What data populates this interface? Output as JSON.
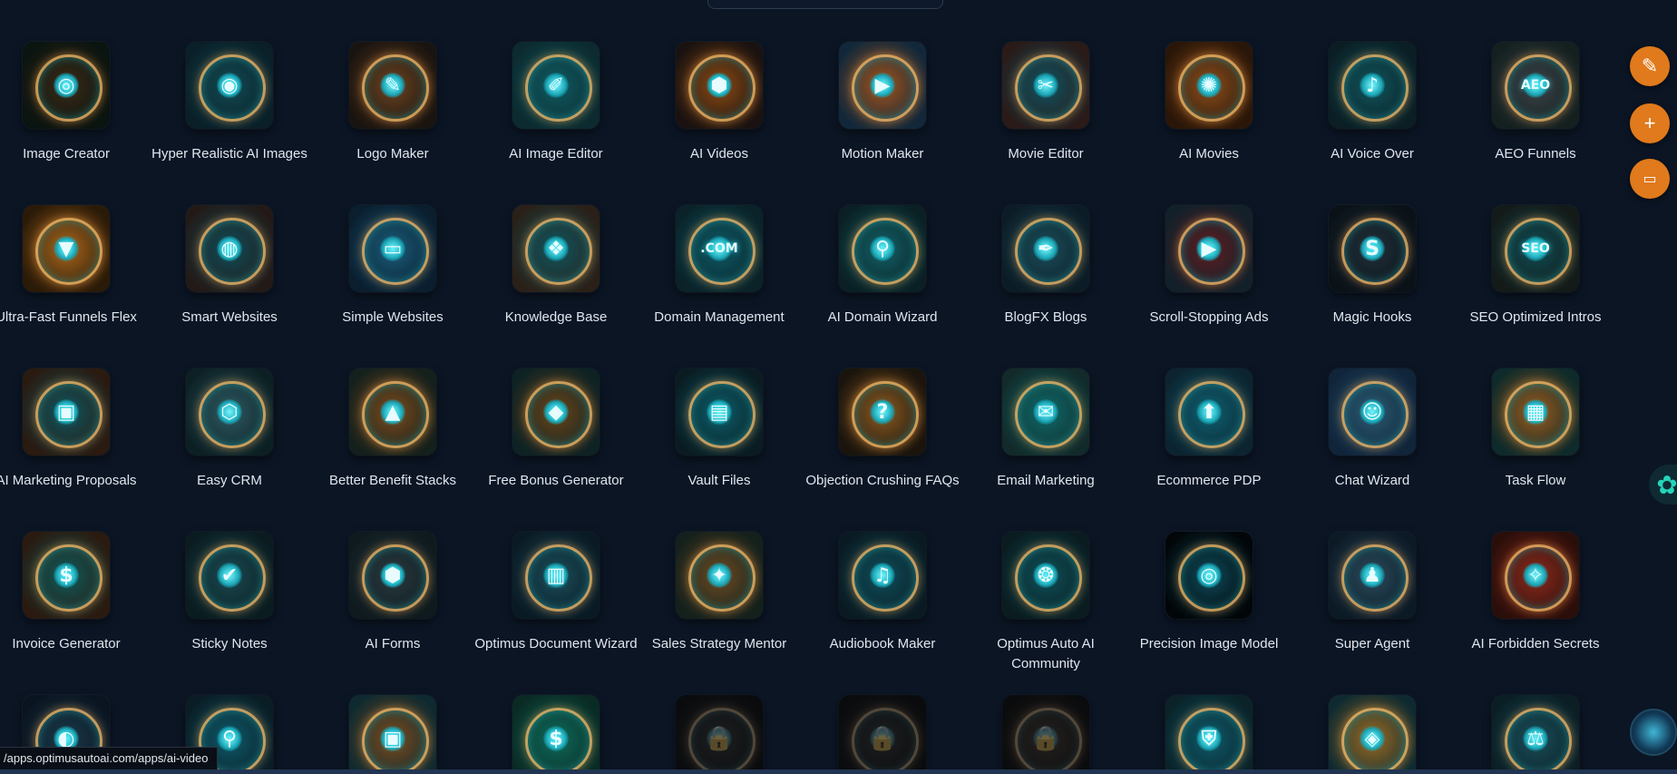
{
  "colors": {
    "background": "#0b1524",
    "accent_orange": "#e07a1c",
    "teal_glow": "#2ee6f0",
    "gold": "#d9a45a"
  },
  "rows": [
    [
      {
        "label": "Image Creator",
        "icon": "camera-lens-icon",
        "glyph": "◎",
        "bg": [
          "#3a2a16",
          "#0a1410"
        ]
      },
      {
        "label": "Hyper Realistic AI Images",
        "icon": "lens-icon",
        "glyph": "◉",
        "bg": [
          "#124a52",
          "#0a1f28"
        ]
      },
      {
        "label": "Logo Maker",
        "icon": "brush-compass-icon",
        "glyph": "✎",
        "bg": [
          "#6a4220",
          "#1a1410"
        ]
      },
      {
        "label": "AI Image Editor",
        "icon": "image-edit-icon",
        "glyph": "✐",
        "bg": [
          "#0f5b62",
          "#0c2a2f"
        ]
      },
      {
        "label": "AI Videos",
        "icon": "video-hexagon-icon",
        "glyph": "⬢",
        "bg": [
          "#8a4a14",
          "#1a1210"
        ]
      },
      {
        "label": "Motion Maker",
        "icon": "play-icon",
        "glyph": "▶",
        "bg": [
          "#a0521a",
          "#12283a"
        ]
      },
      {
        "label": "Movie Editor",
        "icon": "scissors-icon",
        "glyph": "✂",
        "bg": [
          "#0e5260",
          "#2a1a18"
        ]
      },
      {
        "label": "AI Movies",
        "icon": "film-reel-icon",
        "glyph": "✺",
        "bg": [
          "#8a4d1c",
          "#2a1608"
        ]
      },
      {
        "label": "AI Voice Over",
        "icon": "microphone-icon",
        "glyph": "♪",
        "bg": [
          "#11545c",
          "#0a1e24"
        ]
      },
      {
        "label": "AEO Funnels",
        "icon": "aeo-funnel-icon",
        "glyph": "AEO",
        "bg": [
          "#3a4248",
          "#14201f"
        ]
      }
    ],
    [
      {
        "label": "Ultra-Fast Funnels Flex",
        "icon": "funnel-icon",
        "glyph": "▼",
        "bg": [
          "#a8661c",
          "#2a1a08"
        ]
      },
      {
        "label": "Smart Websites",
        "icon": "globe-icon",
        "glyph": "◍",
        "bg": [
          "#0f4c58",
          "#231a18"
        ]
      },
      {
        "label": "Simple Websites",
        "icon": "monitor-icon",
        "glyph": "▭",
        "bg": [
          "#1a5c7a",
          "#0a1e2e"
        ]
      },
      {
        "label": "Knowledge Base",
        "icon": "book-icon",
        "glyph": "❖",
        "bg": [
          "#0e5660",
          "#2a2018"
        ]
      },
      {
        "label": "Domain Management",
        "icon": "domain-icon",
        "glyph": ".COM",
        "bg": [
          "#0e5a66",
          "#0a2228"
        ]
      },
      {
        "label": "AI Domain Wizard",
        "icon": "magnifier-icon",
        "glyph": "⚲",
        "bg": [
          "#126066",
          "#0a2024"
        ]
      },
      {
        "label": "BlogFX Blogs",
        "icon": "pen-circle-icon",
        "glyph": "✒",
        "bg": [
          "#1a4e5a",
          "#0c1c26"
        ]
      },
      {
        "label": "Scroll-Stopping Ads",
        "icon": "play-hexagon-icon",
        "glyph": "▶",
        "bg": [
          "#5a1e20",
          "#12202a"
        ]
      },
      {
        "label": "Magic Hooks",
        "icon": "hook-icon",
        "glyph": "S",
        "bg": [
          "#22303a",
          "#0a1218"
        ]
      },
      {
        "label": "SEO Optimized Intros",
        "icon": "seo-icon",
        "glyph": "SEO",
        "bg": [
          "#0e4c54",
          "#141a18"
        ]
      }
    ],
    [
      {
        "label": "AI Marketing Proposals",
        "icon": "document-shield-icon",
        "glyph": "▣",
        "bg": [
          "#0e5660",
          "#2a1a10"
        ]
      },
      {
        "label": "Easy CRM",
        "icon": "handshake-icon",
        "glyph": "⬡",
        "bg": [
          "#2e5a62",
          "#0c2024"
        ]
      },
      {
        "label": "Better Benefit Stacks",
        "icon": "pyramid-icon",
        "glyph": "▲",
        "bg": [
          "#7a4a1c",
          "#14201c"
        ]
      },
      {
        "label": "Free Bonus Generator",
        "icon": "gift-box-icon",
        "glyph": "◆",
        "bg": [
          "#6a4418",
          "#0e2224"
        ]
      },
      {
        "label": "Vault Files",
        "icon": "vault-icon",
        "glyph": "▤",
        "bg": [
          "#0c5e6a",
          "#0a1c22"
        ]
      },
      {
        "label": "Objection Crushing FAQs",
        "icon": "question-gear-icon",
        "glyph": "?",
        "bg": [
          "#8a5a22",
          "#1a140c"
        ]
      },
      {
        "label": "Email Marketing",
        "icon": "email-icon",
        "glyph": "✉",
        "bg": [
          "#0e6a6a",
          "#122a2a"
        ]
      },
      {
        "label": "Ecommerce PDP",
        "icon": "shopping-bag-icon",
        "glyph": "⬆",
        "bg": [
          "#0e6070",
          "#0c2430"
        ]
      },
      {
        "label": "Chat Wizard",
        "icon": "robot-face-icon",
        "glyph": "☺",
        "bg": [
          "#2a5a70",
          "#10243a"
        ]
      },
      {
        "label": "Task Flow",
        "icon": "task-grid-icon",
        "glyph": "▦",
        "bg": [
          "#9a5a1c",
          "#0e2a2a"
        ]
      }
    ],
    [
      {
        "label": "Invoice Generator",
        "icon": "dollar-document-icon",
        "glyph": "$",
        "bg": [
          "#0e5a5a",
          "#2a1a10"
        ]
      },
      {
        "label": "Sticky Notes",
        "icon": "sticky-note-icon",
        "glyph": "✔",
        "bg": [
          "#1a4a52",
          "#0a1c20"
        ]
      },
      {
        "label": "AI Forms",
        "icon": "form-hexagon-icon",
        "glyph": "⬢",
        "bg": [
          "#2a3a40",
          "#0e1a1e"
        ]
      },
      {
        "label": "Optimus Document Wizard",
        "icon": "document-wizard-icon",
        "glyph": "▥",
        "bg": [
          "#1a4e5a",
          "#0a1a24"
        ]
      },
      {
        "label": "Sales Strategy Mentor",
        "icon": "compass-icon",
        "glyph": "✦",
        "bg": [
          "#6a4a22",
          "#14201c"
        ]
      },
      {
        "label": "Audiobook Maker",
        "icon": "audiobook-icon",
        "glyph": "♫",
        "bg": [
          "#0e4e5a",
          "#0a1a22"
        ]
      },
      {
        "label": "Optimus Auto AI Community",
        "icon": "network-icon",
        "glyph": "❂",
        "bg": [
          "#0e5058",
          "#0a1c20"
        ]
      },
      {
        "label": "Precision Image Model",
        "icon": "aperture-icon",
        "glyph": "◎",
        "bg": [
          "#0e4a5a",
          "#020608"
        ]
      },
      {
        "label": "Super Agent",
        "icon": "robot-agent-icon",
        "glyph": "♟",
        "bg": [
          "#2a4a5a",
          "#0c1a26"
        ]
      },
      {
        "label": "AI Forbidden Secrets",
        "icon": "open-book-icon",
        "glyph": "✧",
        "bg": [
          "#8a2a1c",
          "#2a0e0a"
        ]
      }
    ],
    [
      {
        "label": "",
        "icon": "face-profile-icon",
        "glyph": "◐",
        "bg": [
          "#1a3a4a",
          "#0a1420"
        ]
      },
      {
        "label": "",
        "icon": "magnifier-hexagon-icon",
        "glyph": "⚲",
        "bg": [
          "#0e5a6a",
          "#0a1c24"
        ]
      },
      {
        "label": "",
        "icon": "chat-monitor-icon",
        "glyph": "▣",
        "bg": [
          "#7a4a1c",
          "#0e2a30"
        ]
      },
      {
        "label": "",
        "icon": "dollar-hexagon-icon",
        "glyph": "$",
        "bg": [
          "#0e6a5a",
          "#0a2a24"
        ]
      },
      {
        "label": "",
        "icon": "lock-icon",
        "glyph": "🔒",
        "locked": true,
        "bg": [
          "#3a4450",
          "#14181e"
        ]
      },
      {
        "label": "",
        "icon": "lock-icon",
        "glyph": "🔒",
        "locked": true,
        "bg": [
          "#3a4450",
          "#14181e"
        ]
      },
      {
        "label": "",
        "icon": "lock-icon",
        "glyph": "🔒",
        "locked": true,
        "bg": [
          "#5a4a40",
          "#14181e"
        ]
      },
      {
        "label": "",
        "icon": "shield-icon",
        "glyph": "⛨",
        "bg": [
          "#0e5a6a",
          "#0a2228"
        ]
      },
      {
        "label": "",
        "icon": "cube-icon",
        "glyph": "◈",
        "bg": [
          "#9a6a22",
          "#0e2a30"
        ]
      },
      {
        "label": "",
        "icon": "scales-icon",
        "glyph": "⚖",
        "bg": [
          "#1a4e5a",
          "#0a1e24"
        ]
      }
    ]
  ],
  "floating": {
    "edit_button": "edit-icon",
    "add_button": "plus-icon",
    "folder_button": "folder-icon"
  },
  "status_url": "/apps.optimusautoai.com/apps/ai-video"
}
